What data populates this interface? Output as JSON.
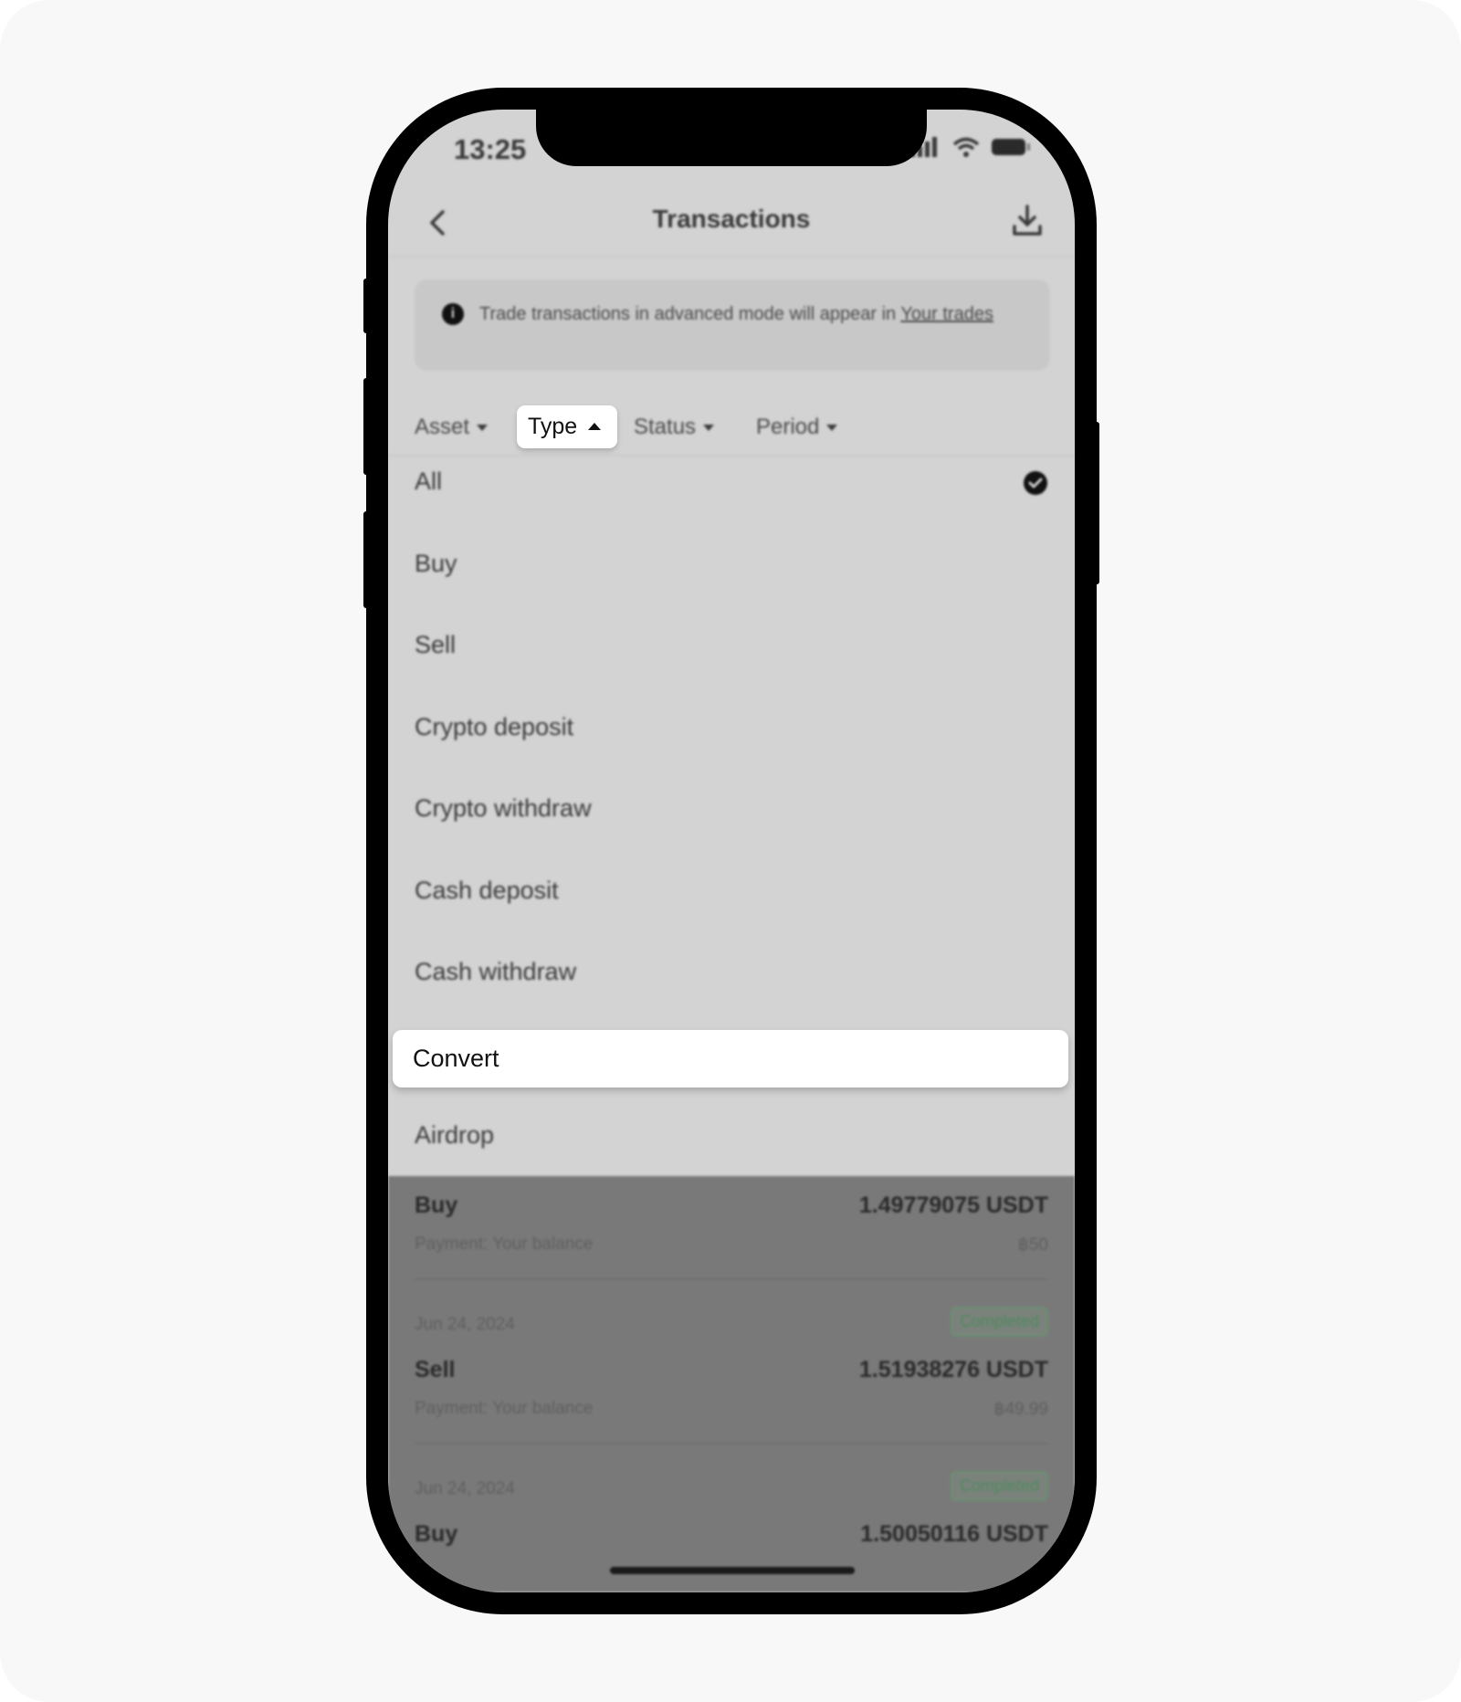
{
  "status_bar": {
    "time": "13:25"
  },
  "header": {
    "title": "Transactions"
  },
  "info_banner": {
    "text": "Trade transactions in advanced mode will appear in ",
    "link": "Your trades"
  },
  "filters": {
    "asset": "Asset",
    "type": "Type",
    "status": "Status",
    "period": "Period"
  },
  "type_options": [
    "All",
    "Buy",
    "Sell",
    "Crypto deposit",
    "Crypto withdraw",
    "Cash deposit",
    "Cash withdraw",
    "Convert",
    "Airdrop"
  ],
  "selected_option": "All",
  "highlighted_option": "Convert",
  "transactions": [
    {
      "type": "Buy",
      "amount": "1.49779075 USDT",
      "payment": "Payment: Your balance",
      "fiat": "฿50"
    },
    {
      "date": "Jun 24, 2024",
      "status": "Completed",
      "type": "Sell",
      "amount": "1.51938276 USDT",
      "payment": "Payment: Your balance",
      "fiat": "฿49.99"
    },
    {
      "date": "Jun 24, 2024",
      "status": "Completed",
      "type": "Buy",
      "amount": "1.50050116 USDT"
    }
  ],
  "colors": {
    "dim_overlay": "#d3d3d3",
    "list_overlay": "#797979",
    "status_green": "#4e8a5e"
  }
}
